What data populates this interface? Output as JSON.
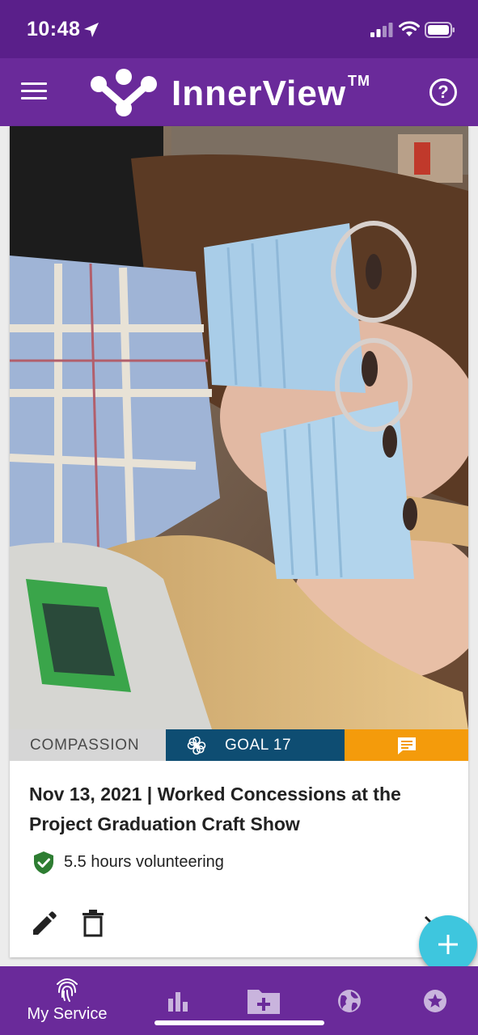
{
  "status_bar": {
    "time": "10:48"
  },
  "header": {
    "logo_text": "InnerView",
    "logo_tm": "TM",
    "help_label": "?"
  },
  "entry": {
    "category": "COMPASSION",
    "goal": "GOAL 17",
    "title": "Nov 13, 2021 | Worked Concessions at the Project Graduation Craft Show",
    "hours": "5.5 hours volunteering"
  },
  "bottom_nav": {
    "my_service_label": "My Service"
  },
  "colors": {
    "status_bar": "#5a1f8a",
    "header": "#6a2a9a",
    "compassion_tag": "#d6d6d6",
    "goal_tag": "#0e4d72",
    "comment_tag": "#f49b0b",
    "fab": "#3ec6de",
    "verified_shield": "#2e7d32"
  },
  "icons": {
    "menu": "menu-icon",
    "help": "help-icon",
    "goal": "flower-icon",
    "comment": "comment-icon",
    "verified": "shield-check-icon",
    "edit": "pencil-icon",
    "delete": "trash-icon",
    "fab": "plus-icon",
    "my_service": "fingerprint-icon",
    "stats": "bar-chart-icon",
    "add_entry": "folder-plus-icon",
    "globe": "globe-icon",
    "star": "star-badge-icon"
  }
}
